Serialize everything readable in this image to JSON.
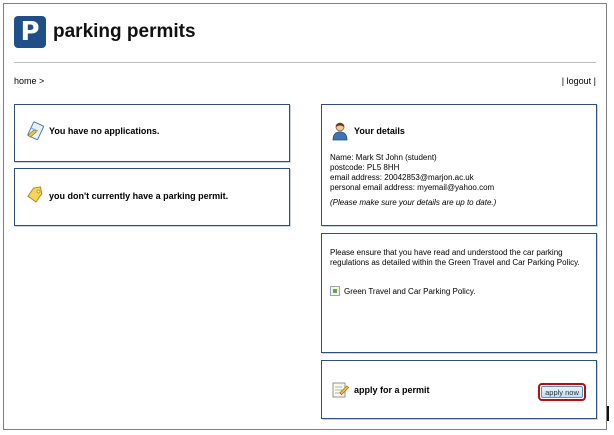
{
  "header": {
    "logo_letter": "P",
    "title": "parking permits"
  },
  "nav": {
    "breadcrumb": "home >",
    "logout": "| logout |"
  },
  "left": {
    "applications_text": "You have no applications.",
    "permit_text": "you don't currently have a parking permit."
  },
  "details": {
    "title": "Your details",
    "name": "Name: Mark St John (student)",
    "postcode": "postcode: PL5 8HH",
    "email": "email address: 20042853@marjon.ac.uk",
    "personal_email": "personal email address: myemail@yahoo.com",
    "note": "(Please make sure your details are up to date.)"
  },
  "policy": {
    "text": "Please ensure that you have read and understood the car parking regulations as detailed within the Green Travel and Car Parking Policy.",
    "link_text": "Green Travel and Car Parking Policy."
  },
  "apply": {
    "label": "apply for a permit",
    "button": "apply now"
  },
  "colors": {
    "brand": "#1f4f86",
    "panel_border": "#2e4f7a",
    "highlight": "#b00f16"
  }
}
